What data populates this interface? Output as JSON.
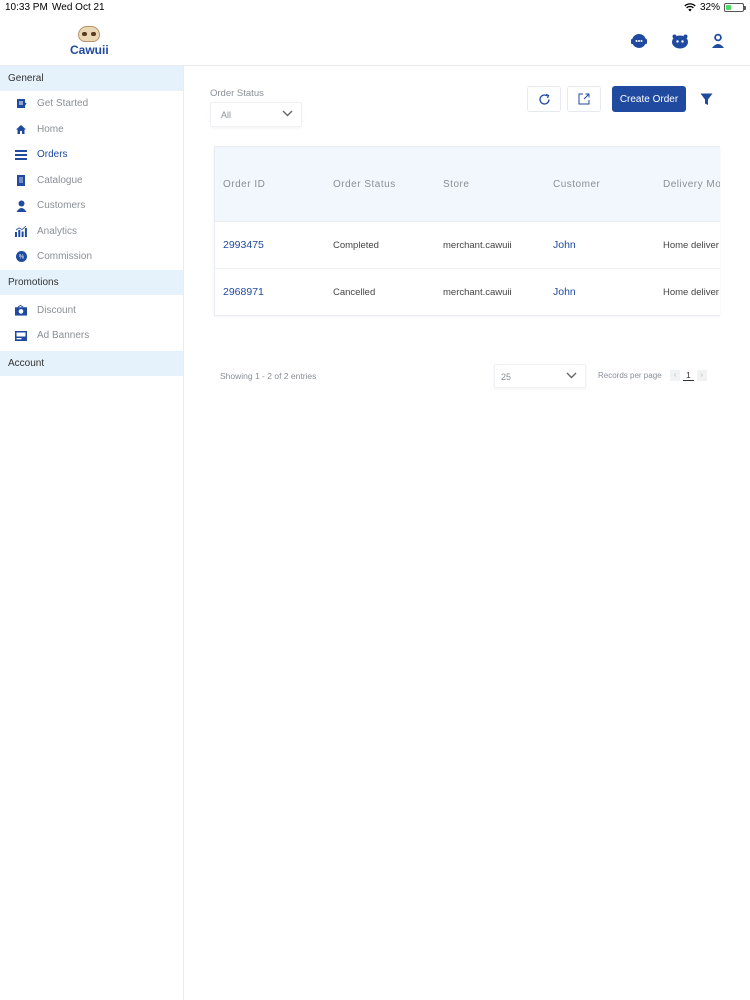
{
  "status_bar": {
    "time": "10:33 PM",
    "date": "Wed Oct 21",
    "battery": "32%"
  },
  "header": {
    "app_name": "Cawuii",
    "icons": [
      "support-chat-icon",
      "mascot-icon",
      "user-icon"
    ]
  },
  "sidebar": {
    "sections": [
      {
        "title": "General",
        "items": [
          {
            "label": "Get Started",
            "icon": "get-started-icon"
          },
          {
            "label": "Home",
            "icon": "home-icon"
          },
          {
            "label": "Orders",
            "icon": "orders-icon",
            "active": true
          },
          {
            "label": "Catalogue",
            "icon": "catalogue-icon"
          },
          {
            "label": "Customers",
            "icon": "customers-icon"
          },
          {
            "label": "Analytics",
            "icon": "analytics-icon"
          },
          {
            "label": "Commission",
            "icon": "commission-icon"
          }
        ]
      },
      {
        "title": "Promotions",
        "items": [
          {
            "label": "Discount",
            "icon": "discount-icon"
          },
          {
            "label": "Ad Banners",
            "icon": "ad-banners-icon"
          }
        ]
      },
      {
        "title": "Account",
        "items": []
      }
    ]
  },
  "filters": {
    "order_status_label": "Order Status",
    "order_status_value": "All"
  },
  "toolbar": {
    "create_order_label": "Create Order",
    "icons": [
      "refresh-icon",
      "export-icon",
      "filter-icon"
    ]
  },
  "table": {
    "columns": [
      "Order ID",
      "Order Status",
      "Store",
      "Customer",
      "Delivery Mo"
    ],
    "rows": [
      [
        "2993475",
        "Completed",
        "merchant.cawuii",
        "John",
        "Home deliver"
      ],
      [
        "2968971",
        "Cancelled",
        "merchant.cawuii",
        "John",
        "Home deliver"
      ]
    ]
  },
  "footer": {
    "showing_text": "Showing 1 - 2 of 2 entries",
    "page_size": "25",
    "records_per_page_label": "Records per page",
    "current_page": "1",
    "prev_arrow": "‹",
    "next_arrow": "›"
  },
  "colors": {
    "primary": "#1f4aa0",
    "section_bg": "#e5f1fb",
    "table_header_bg": "#f1f7fc"
  }
}
